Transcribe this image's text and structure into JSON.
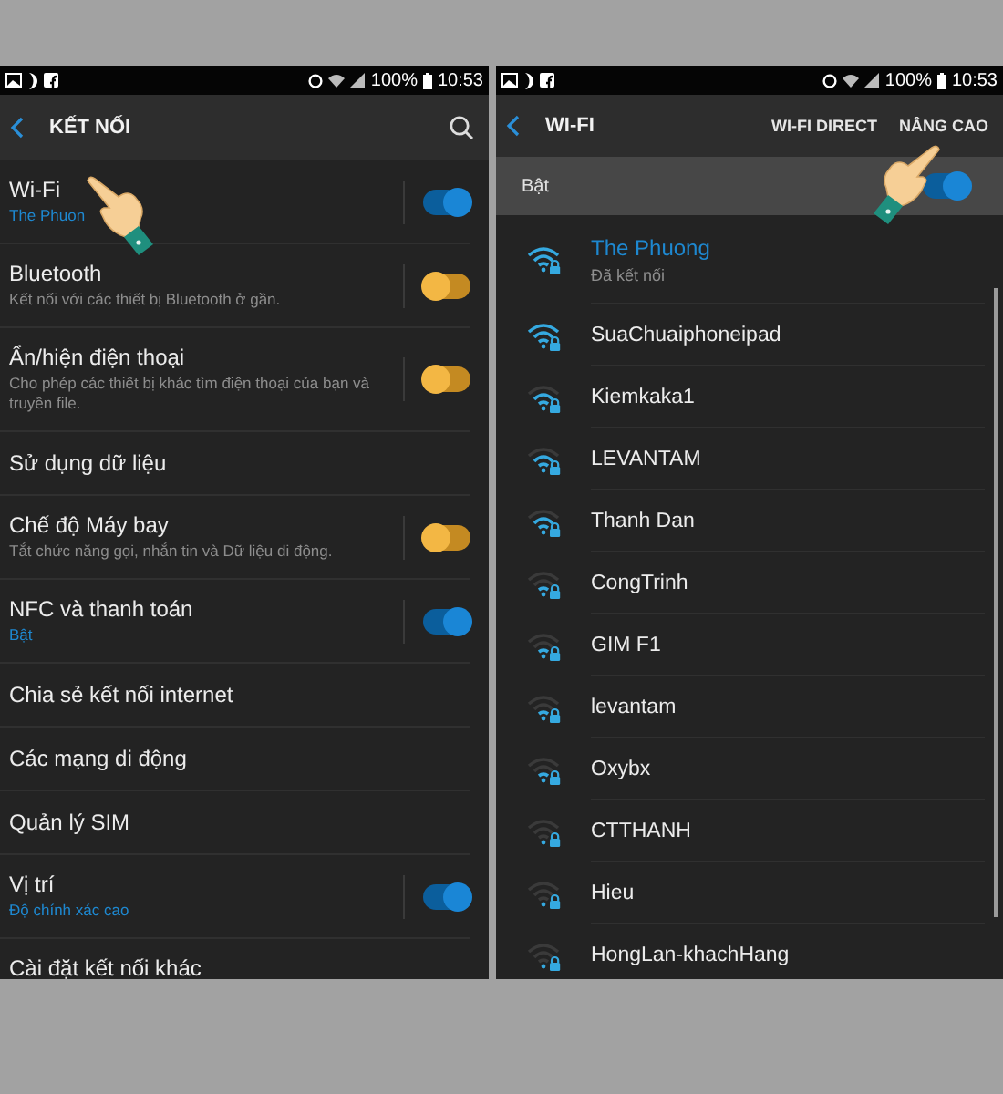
{
  "connections_screen": {
    "status_bar": {
      "battery": "100%",
      "time": "10:53"
    },
    "header": {
      "title": "KẾT NỐI"
    },
    "settings": [
      {
        "kind": "switch",
        "title": "Wi-Fi",
        "subtitle": "The Phuon",
        "subtitle_highlighted": true,
        "on": true
      },
      {
        "kind": "switch",
        "title": "Bluetooth",
        "subtitle": "Kết nối với các thiết bị Bluetooth ở gần.",
        "subtitle_highlighted": false,
        "on": false
      },
      {
        "kind": "switch",
        "title": "Ẩn/hiện điện thoại",
        "subtitle": "Cho phép các thiết bị khác tìm điện thoại của bạn và truyền file.",
        "subtitle_highlighted": false,
        "on": false
      },
      {
        "kind": "link",
        "title": "Sử dụng dữ liệu"
      },
      {
        "kind": "switch",
        "title": "Chế độ Máy bay",
        "subtitle": "Tắt chức năng gọi, nhắn tin và Dữ liệu di động.",
        "subtitle_highlighted": false,
        "on": false
      },
      {
        "kind": "switch",
        "title": "NFC và thanh toán",
        "subtitle": "Bật",
        "subtitle_highlighted": true,
        "on": true
      },
      {
        "kind": "link",
        "title": "Chia sẻ kết nối internet"
      },
      {
        "kind": "link",
        "title": "Các mạng di động"
      },
      {
        "kind": "link",
        "title": "Quản lý SIM"
      },
      {
        "kind": "switch",
        "title": "Vị trí",
        "subtitle": "Độ chính xác cao",
        "subtitle_highlighted": true,
        "on": true
      },
      {
        "kind": "link",
        "title": "Cài đặt kết nối khác"
      }
    ]
  },
  "wifi_screen": {
    "status_bar": {
      "battery": "100%",
      "time": "10:53"
    },
    "header": {
      "title": "WI-FI",
      "actions": [
        "WI-FI DIRECT",
        "NÂNG CAO"
      ]
    },
    "master_switch": {
      "label": "Bật",
      "on": true
    },
    "networks": [
      {
        "kind": "strong",
        "name": "The Phuong",
        "status": "Đã kết nối",
        "connected": true
      },
      {
        "kind": "strong",
        "name": "SuaChuaiphoneipad",
        "connected": false
      },
      {
        "kind": "good",
        "name": "Kiemkaka1",
        "connected": false
      },
      {
        "kind": "good",
        "name": "LEVANTAM",
        "connected": false
      },
      {
        "kind": "good",
        "name": "Thanh Dan",
        "connected": false
      },
      {
        "kind": "fair",
        "name": "CongTrinh",
        "connected": false
      },
      {
        "kind": "fair",
        "name": "GIM F1",
        "connected": false
      },
      {
        "kind": "fair",
        "name": "levantam",
        "connected": false
      },
      {
        "kind": "fair",
        "name": "Oxybx",
        "connected": false
      },
      {
        "kind": "weak",
        "name": "CTTHANH",
        "connected": false
      },
      {
        "kind": "weak",
        "name": "Hieu",
        "connected": false
      },
      {
        "kind": "weak",
        "name": "HongLan-khachHang",
        "connected": false
      }
    ]
  }
}
